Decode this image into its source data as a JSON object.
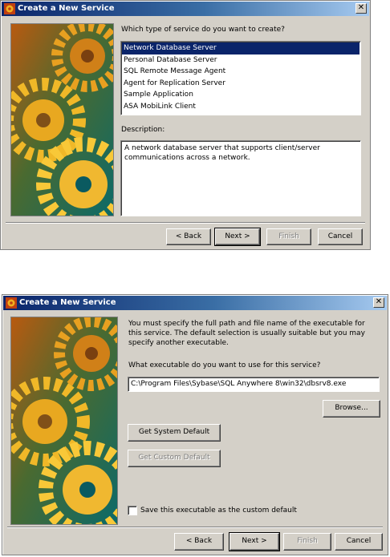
{
  "dialog1": {
    "title": "Create a New Service",
    "question_label": "Which type of service do you want to create?",
    "service_types": [
      "Network Database Server",
      "Personal Database Server",
      "SQL Remote Message Agent",
      "Agent for Replication Server",
      "Sample Application",
      "ASA MobiLink Client"
    ],
    "selected_index": 0,
    "description_label": "Description:",
    "description_text": "A network database server that supports client/server communications across a network.",
    "buttons": {
      "back": "< Back",
      "next": "Next >",
      "finish": "Finish",
      "cancel": "Cancel"
    }
  },
  "dialog2": {
    "title": "Create a New Service",
    "intro_text": "You must specify the full path and file name of the executable for this service. The default selection is usually suitable but you may specify another executable.",
    "executable_label": "What executable do you want to use for this service?",
    "executable_value": "C:\\Program Files\\Sybase\\SQL Anywhere 8\\win32\\dbsrv8.exe",
    "browse_label": "Browse...",
    "get_system_default_label": "Get System Default",
    "get_custom_default_label": "Get Custom Default",
    "save_custom_default_label": "Save this executable as the custom default",
    "save_custom_default_checked": false,
    "buttons": {
      "back": "< Back",
      "next": "Next >",
      "finish": "Finish",
      "cancel": "Cancel"
    }
  },
  "colors": {
    "titlebar_start": "#0a246a",
    "titlebar_end": "#a6caf0",
    "dialog_face": "#d4d0c8",
    "selection": "#0a246a"
  }
}
